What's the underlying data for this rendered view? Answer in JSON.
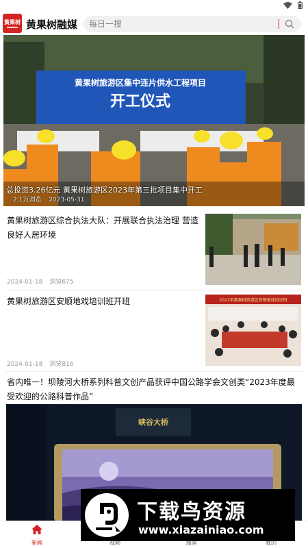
{
  "app": {
    "logo_text_top": "黄果树",
    "title": "黄果树融媒"
  },
  "search": {
    "placeholder": "每日一搜"
  },
  "hero": {
    "banner_line1": "黄果树旅游区集中连片供水工程项目",
    "banner_line2": "开工仪式",
    "caption": "总投资3.26亿元 黄果树旅游区2023年第三批项目集中开工",
    "views": "2.1万浏览",
    "date": "2023-05-31"
  },
  "news": [
    {
      "title": "黄果树旅游区综合执法大队：开展联合执法治理 营造良好人居环境",
      "date": "2024-01-18",
      "views": "浏览675"
    },
    {
      "title": "黄果树旅游区安顺地戏培训班开班",
      "date": "2024-01-18",
      "views": "浏览816",
      "thumb_banner": "2023年黄果树旅游区安顺地戏培训班"
    }
  ],
  "feature": {
    "title": "省内唯一！坝陵河大桥系列科普文创产品获评中国公路学会文创类“2023年度最受欢迎的公路科普作品”",
    "sign_text": "峡谷大桥"
  },
  "tabs": [
    {
      "label": "新闻",
      "icon": "home-icon"
    },
    {
      "label": "视频",
      "icon": "video-icon"
    },
    {
      "label": "服务",
      "icon": "service-icon"
    },
    {
      "label": "我的",
      "icon": "user-icon"
    }
  ],
  "watermark": {
    "title": "下载鸟资源",
    "url": "www.xiazainiao.com"
  },
  "colors": {
    "accent": "#d32424"
  }
}
